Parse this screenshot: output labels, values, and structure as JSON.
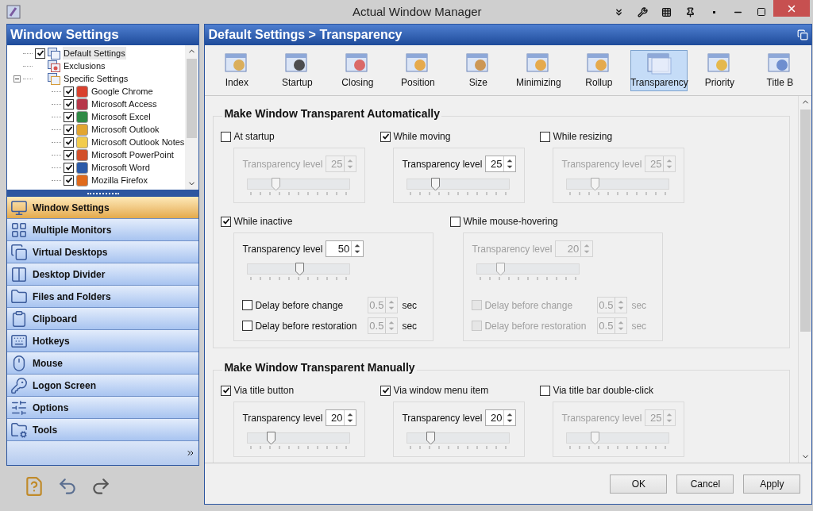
{
  "window": {
    "title": "Actual Window Manager"
  },
  "left_panel": {
    "title": "Window Settings",
    "tree": [
      {
        "label": "Default Settings",
        "kind": "checkbox",
        "checked": true,
        "selected": true
      },
      {
        "label": "Exclusions",
        "kind": "plain",
        "selected": false
      },
      {
        "label": "Specific Settings",
        "kind": "plain",
        "selected": false,
        "expanded": true,
        "children": [
          {
            "label": "Google Chrome",
            "kind": "checkbox",
            "checked": true,
            "selected": false
          },
          {
            "label": "Microsoft Access",
            "kind": "checkbox",
            "checked": true,
            "selected": false
          },
          {
            "label": "Microsoft Excel",
            "kind": "checkbox",
            "checked": true,
            "selected": false
          },
          {
            "label": "Microsoft Outlook",
            "kind": "checkbox",
            "checked": true,
            "selected": false
          },
          {
            "label": "Microsoft Outlook Notes",
            "kind": "checkbox",
            "checked": true,
            "selected": false
          },
          {
            "label": "Microsoft PowerPoint",
            "kind": "checkbox",
            "checked": true,
            "selected": false
          },
          {
            "label": "Microsoft Word",
            "kind": "checkbox",
            "checked": true,
            "selected": false
          },
          {
            "label": "Mozilla Firefox",
            "kind": "checkbox",
            "checked": true,
            "selected": false
          }
        ]
      }
    ],
    "nav": [
      {
        "label": "Window Settings",
        "selected": true
      },
      {
        "label": "Multiple Monitors",
        "selected": false
      },
      {
        "label": "Virtual Desktops",
        "selected": false
      },
      {
        "label": "Desktop Divider",
        "selected": false
      },
      {
        "label": "Files and Folders",
        "selected": false
      },
      {
        "label": "Clipboard",
        "selected": false
      },
      {
        "label": "Hotkeys",
        "selected": false
      },
      {
        "label": "Mouse",
        "selected": false
      },
      {
        "label": "Logon Screen",
        "selected": false
      },
      {
        "label": "Options",
        "selected": false
      },
      {
        "label": "Tools",
        "selected": false
      }
    ]
  },
  "right_panel": {
    "breadcrumb": "Default Settings > Transparency",
    "toolbar": [
      {
        "label": "Index",
        "selected": false
      },
      {
        "label": "Startup",
        "selected": false
      },
      {
        "label": "Closing",
        "selected": false
      },
      {
        "label": "Position",
        "selected": false
      },
      {
        "label": "Size",
        "selected": false
      },
      {
        "label": "Minimizing",
        "selected": false
      },
      {
        "label": "Rollup",
        "selected": false
      },
      {
        "label": "Transparency",
        "selected": true
      },
      {
        "label": "Priority",
        "selected": false
      },
      {
        "label": "Title B",
        "selected": false
      }
    ],
    "sections": [
      {
        "title": "Make Window Transparent Automatically",
        "rows": [
          [
            {
              "label": "At startup",
              "checked": false,
              "level_label": "Transparency level",
              "value": "25",
              "level": 0.25
            },
            {
              "label": "While moving",
              "checked": true,
              "level_label": "Transparency level",
              "value": "25",
              "level": 0.25
            },
            {
              "label": "While resizing",
              "checked": false,
              "level_label": "Transparency level",
              "value": "25",
              "level": 0.25
            }
          ],
          [
            {
              "label": "While inactive",
              "checked": true,
              "level_label": "Transparency level",
              "value": "50",
              "level": 0.5,
              "delays": [
                {
                  "label": "Delay before change",
                  "checked": false,
                  "value": "0.5",
                  "unit": "sec"
                },
                {
                  "label": "Delay before restoration",
                  "checked": false,
                  "value": "0.5",
                  "unit": "sec"
                }
              ]
            },
            {
              "label": "While mouse-hovering",
              "checked": false,
              "level_label": "Transparency level",
              "value": "20",
              "level": 0.2,
              "delays": [
                {
                  "label": "Delay before change",
                  "checked": false,
                  "value": "0.5",
                  "unit": "sec"
                },
                {
                  "label": "Delay before restoration",
                  "checked": false,
                  "value": "0.5",
                  "unit": "sec"
                }
              ]
            }
          ]
        ]
      },
      {
        "title": "Make Window Transparent Manually",
        "rows": [
          [
            {
              "label": "Via title button",
              "checked": true,
              "level_label": "Transparency level",
              "value": "20",
              "level": 0.2
            },
            {
              "label": "Via window menu item",
              "checked": true,
              "level_label": "Transparency level",
              "value": "20",
              "level": 0.2
            },
            {
              "label": "Via title bar double-click",
              "checked": false,
              "level_label": "Transparency level",
              "value": "25",
              "level": 0.25
            }
          ]
        ]
      }
    ],
    "buttons": [
      "OK",
      "Cancel",
      "Apply"
    ]
  }
}
